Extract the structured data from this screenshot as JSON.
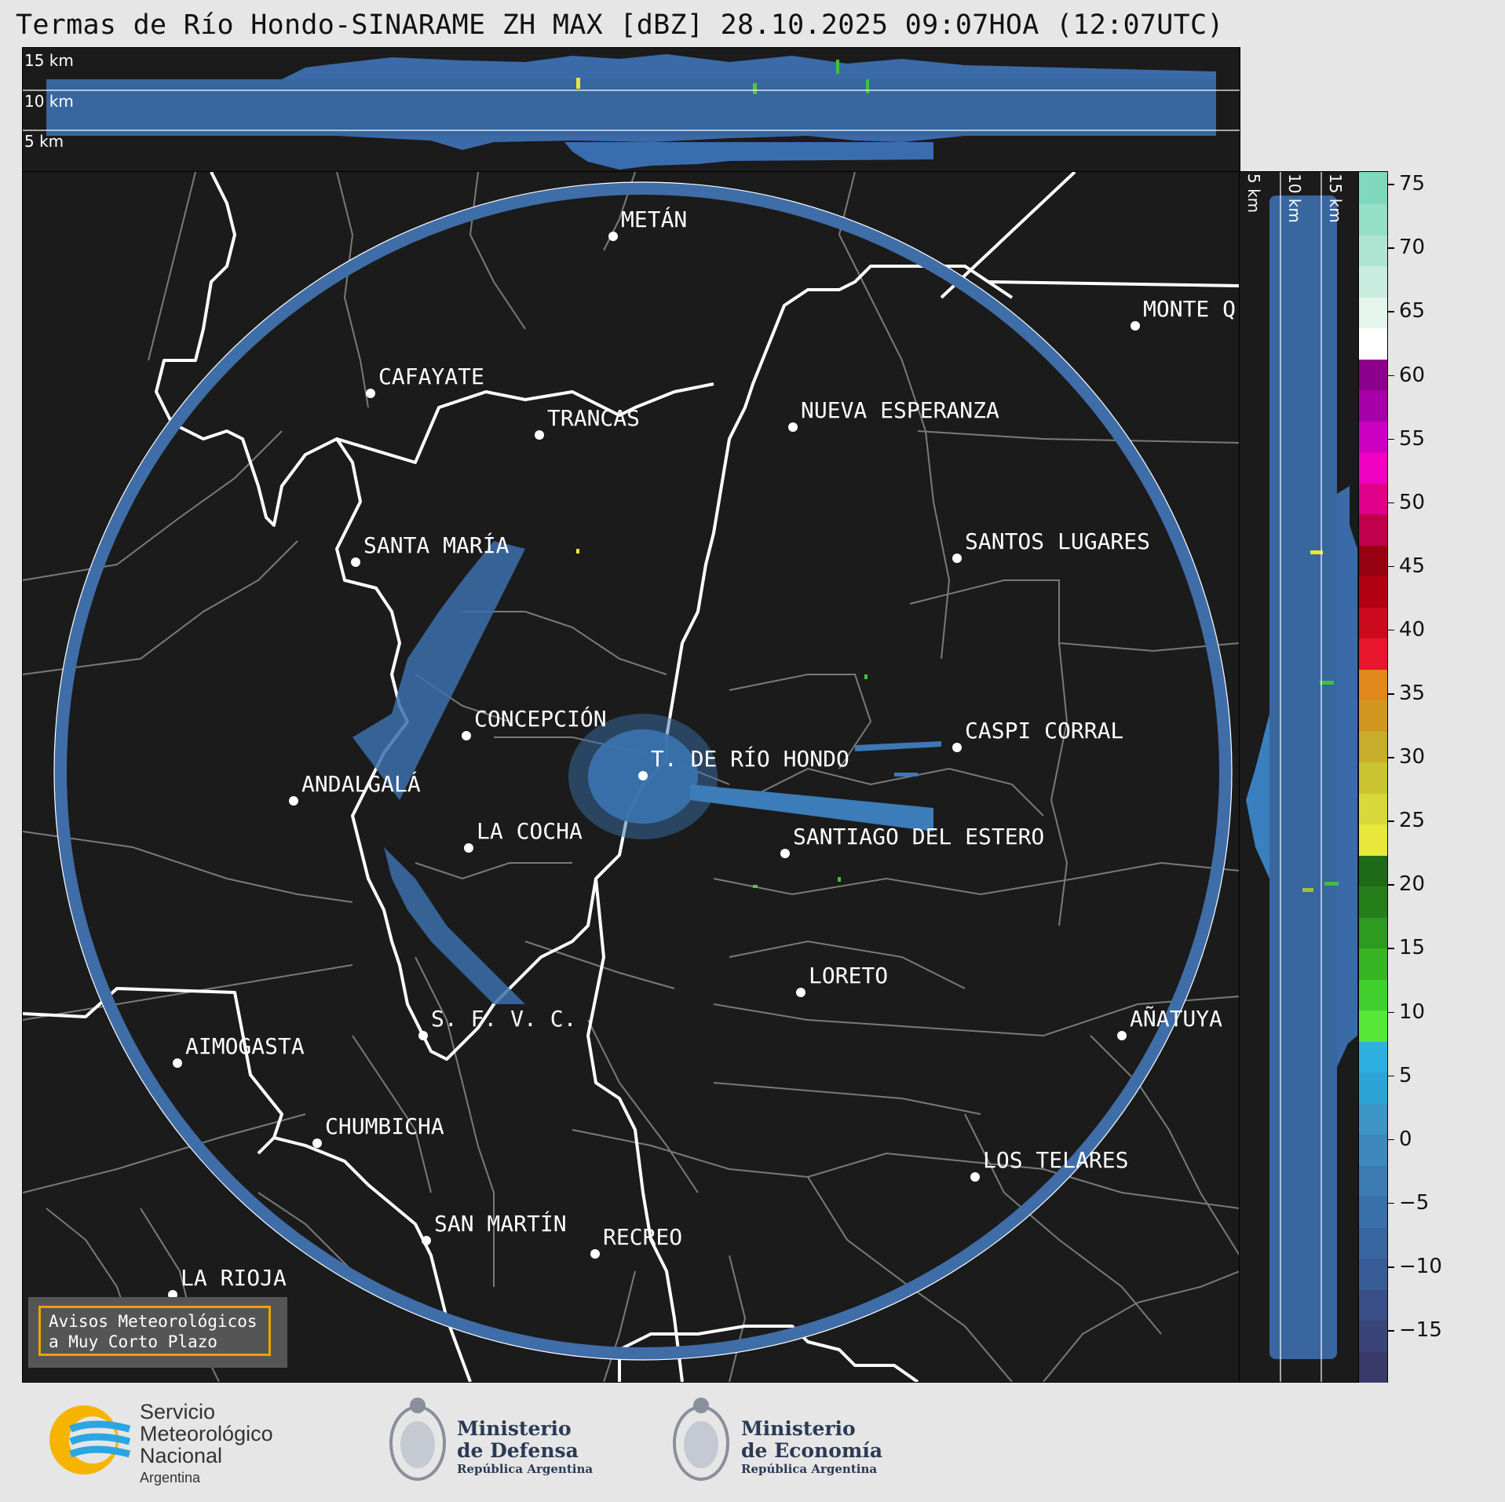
{
  "title": "Termas de Río Hondo-SINARAME ZH MAX [dBZ] 28.10.2025 09:07HOA (12:07UTC)",
  "top_panel": {
    "alt_labels": [
      "15 km",
      "10 km",
      "5 km"
    ]
  },
  "side_panel": {
    "alt_labels": [
      "5 km",
      "10 km",
      "15 km"
    ]
  },
  "colorbar": {
    "units": "dBZ",
    "ticks": [
      "75",
      "70",
      "65",
      "60",
      "55",
      "50",
      "45",
      "40",
      "35",
      "30",
      "25",
      "20",
      "15",
      "10",
      "5",
      "0",
      "−5",
      "−10",
      "−15"
    ],
    "range": [
      -19,
      76
    ],
    "colors": [
      "#3a3a6a",
      "#3a4478",
      "#3a4f88",
      "#385c96",
      "#3766a0",
      "#3a70aa",
      "#3c7cb3",
      "#3d88bd",
      "#3d94c6",
      "#2ea3d6",
      "#2db0e0",
      "#58e83a",
      "#3fcf2c",
      "#36b424",
      "#2d9a20",
      "#247f1a",
      "#1e6a16",
      "#e9e63c",
      "#d9d83a",
      "#cac431",
      "#c8ad2a",
      "#d19820",
      "#e0891a",
      "#e8152c",
      "#cc0a1e",
      "#b00012",
      "#960010",
      "#c0004a",
      "#e0008a",
      "#f000c0",
      "#cc00c0",
      "#a800a8",
      "#8c008c",
      "#ffffff",
      "#e4f5ec",
      "#c8ede0",
      "#aee6d3",
      "#94dfc6",
      "#7fd8bb"
    ]
  },
  "map": {
    "cities": [
      {
        "name": "METÁN"
      },
      {
        "name": "MONTE Q"
      },
      {
        "name": "CAFAYATE"
      },
      {
        "name": "TRANCAS"
      },
      {
        "name": "NUEVA ESPERANZA"
      },
      {
        "name": "SANTA MARÍA"
      },
      {
        "name": "SANTOS LUGARES"
      },
      {
        "name": "CONCEPCIÓN"
      },
      {
        "name": "CASPI CORRAL"
      },
      {
        "name": "T. DE RÍO HONDO"
      },
      {
        "name": "ANDALGALÁ"
      },
      {
        "name": "LA COCHA"
      },
      {
        "name": "SANTIAGO DEL ESTERO"
      },
      {
        "name": "LORETO"
      },
      {
        "name": "S. F. V. C."
      },
      {
        "name": "AÑATUYA"
      },
      {
        "name": "AIMOGASTA"
      },
      {
        "name": "CHUMBICHA"
      },
      {
        "name": "LOS TELARES"
      },
      {
        "name": "SAN MARTÍN"
      },
      {
        "name": "RECREO"
      },
      {
        "name": "LA RIOJA"
      }
    ]
  },
  "warning_box": {
    "line1": "Avisos Meteorológicos",
    "line2": "a Muy Corto Plazo"
  },
  "footer": {
    "smn": {
      "line1": "Servicio",
      "line2": "Meteorológico",
      "line3": "Nacional",
      "line4": "Argentina"
    },
    "defensa": {
      "line1": "Ministerio",
      "line2": "de Defensa",
      "line3": "República Argentina"
    },
    "economia": {
      "line1": "Ministerio",
      "line2": "de Economía",
      "line3": "República Argentina"
    }
  }
}
